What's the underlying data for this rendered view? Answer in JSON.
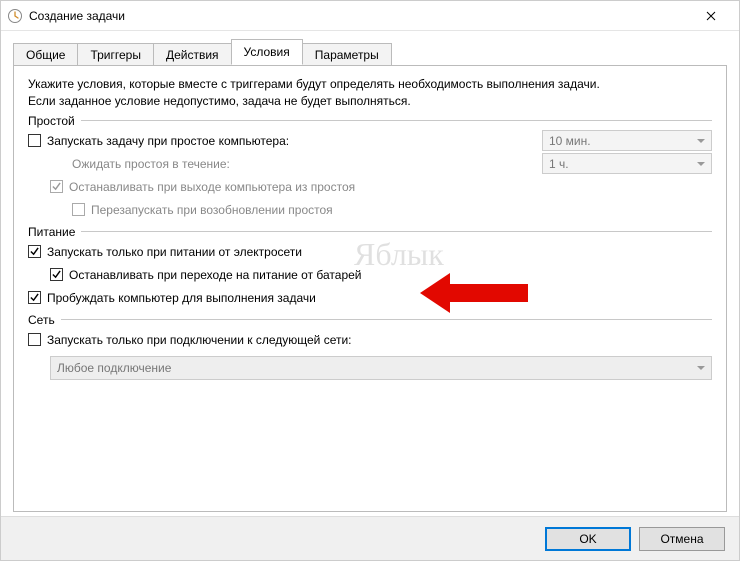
{
  "window": {
    "title": "Создание задачи"
  },
  "tabs": {
    "general": "Общие",
    "triggers": "Триггеры",
    "actions": "Действия",
    "conditions": "Условия",
    "settings": "Параметры"
  },
  "intro": {
    "line1": "Укажите условия, которые вместе с триггерами будут определять необходимость выполнения задачи.",
    "line2": "Если заданное условие недопустимо, задача не будет выполняться."
  },
  "groups": {
    "idle": "Простой",
    "power": "Питание",
    "network": "Сеть"
  },
  "idle": {
    "start_on_idle": "Запускать задачу при простое компьютера:",
    "wait_for_idle": "Ожидать простоя в течение:",
    "stop_on_idle_end": "Останавливать при выходе компьютера из простоя",
    "restart_on_idle": "Перезапускать при возобновлении простоя",
    "idle_duration": "10 мин.",
    "idle_wait": "1 ч."
  },
  "power": {
    "on_ac": "Запускать только при питании от электросети",
    "stop_on_battery": "Останавливать при переходе на питание от батарей",
    "wake_to_run": "Пробуждать компьютер для выполнения задачи"
  },
  "network": {
    "only_if_network": "Запускать только при подключении к следующей сети:",
    "any_connection": "Любое подключение"
  },
  "buttons": {
    "ok": "OK",
    "cancel": "Отмена"
  },
  "watermark": "Яблык"
}
